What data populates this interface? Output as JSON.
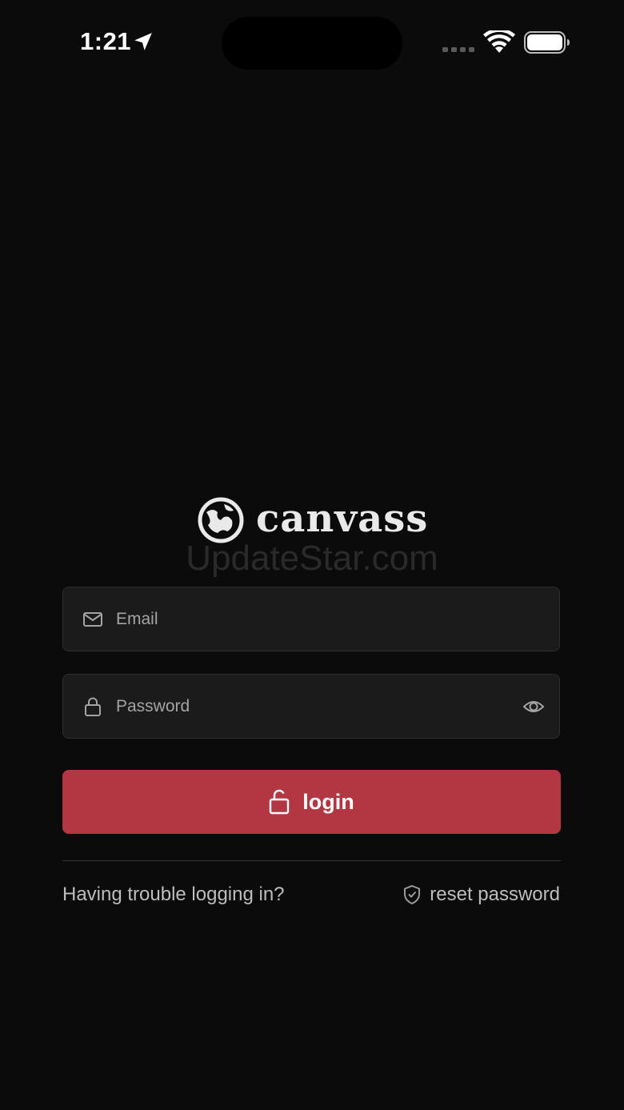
{
  "status_bar": {
    "time": "1:21"
  },
  "logo": {
    "text": "canvass",
    "watermark": "UpdateStar.com"
  },
  "form": {
    "email_placeholder": "Email",
    "password_placeholder": "Password",
    "login_label": "login"
  },
  "footer": {
    "trouble_label": "Having trouble logging in?",
    "reset_label": "reset password"
  },
  "colors": {
    "background": "#0b0b0b",
    "accent": "#b23743",
    "field_background": "#1b1b1b"
  },
  "icons": {
    "email": "envelope-icon",
    "password": "lock-icon",
    "reveal": "eye-icon",
    "login": "unlock-icon",
    "reset": "shield-icon"
  }
}
